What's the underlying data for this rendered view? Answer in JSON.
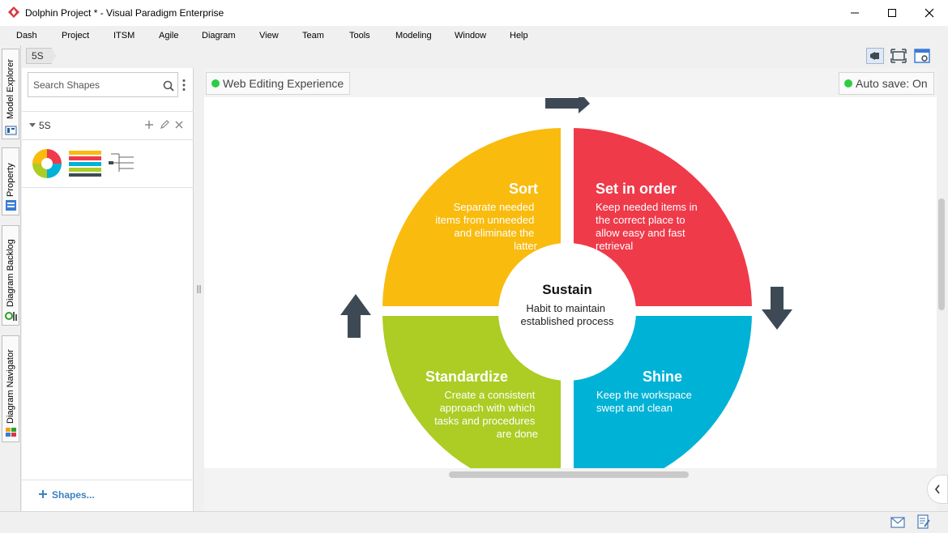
{
  "window": {
    "title": "Dolphin Project * - Visual Paradigm Enterprise",
    "controls": [
      "minimize",
      "maximize",
      "close"
    ]
  },
  "menu": [
    "Dash",
    "Project",
    "ITSM",
    "Agile",
    "Diagram",
    "View",
    "Team",
    "Tools",
    "Modeling",
    "Window",
    "Help"
  ],
  "left_tabs": {
    "model_explorer": "Model Explorer",
    "property": "Property",
    "diagram_backlog": "Diagram Backlog",
    "diagram_navigator": "Diagram Navigator"
  },
  "breadcrumb": "5S",
  "shapes_panel": {
    "search_placeholder": "Search Shapes",
    "section": "5S",
    "add_shapes": "Shapes..."
  },
  "canvas": {
    "web_editing": "Web Editing Experience",
    "autosave": "Auto save: On"
  },
  "diagram": {
    "center": {
      "title": "Sustain",
      "text": [
        "Habit to maintain",
        "established process"
      ]
    },
    "quadrants": [
      {
        "id": "sort",
        "title": "Sort",
        "text": [
          "Separate needed",
          "items from unneeded",
          "and eliminate the",
          "latter"
        ],
        "color": "#f9bb0e"
      },
      {
        "id": "set-in-order",
        "title": "Set in order",
        "text": [
          "Keep needed items in",
          "the correct place to",
          "allow easy and fast",
          "retrieval"
        ],
        "color": "#ef3a4a"
      },
      {
        "id": "standardize",
        "title": "Standardize",
        "text": [
          "Create a consistent",
          "approach with which",
          "tasks and procedures",
          "are done"
        ],
        "color": "#adcc24"
      },
      {
        "id": "shine",
        "title": "Shine",
        "text": [
          "Keep the workspace",
          "swept and clean"
        ],
        "color": "#00b2d6"
      }
    ],
    "arrow_color": "#3d4a55"
  }
}
